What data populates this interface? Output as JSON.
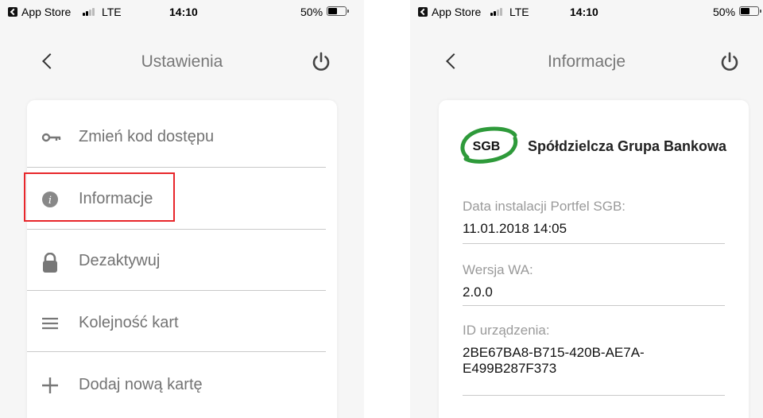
{
  "left": {
    "status": {
      "app": "App Store",
      "network": "LTE",
      "time": "14:10",
      "battery": "50%",
      "battery_level": 0.5
    },
    "nav": {
      "title": "Ustawienia"
    },
    "menu": [
      {
        "label": "Zmień kod dostępu",
        "icon": "key-icon"
      },
      {
        "label": "Informacje",
        "icon": "info-icon"
      },
      {
        "label": "Dezaktywuj",
        "icon": "lock-icon"
      },
      {
        "label": "Kolejność kart",
        "icon": "menu-icon"
      },
      {
        "label": "Dodaj nową kartę",
        "icon": "plus-icon"
      }
    ],
    "highlight_color": "#e8262b"
  },
  "right": {
    "status": {
      "app": "App Store",
      "network": "LTE",
      "time": "14:10",
      "battery": "50%",
      "battery_level": 0.5
    },
    "nav": {
      "title": "Informacje"
    },
    "logo_text": "SGB",
    "bank_name": "Spółdzielcza Grupa Bankowa",
    "install_label": "Data instalacji Portfel SGB:",
    "install_value": "11.01.2018 14:05",
    "version_label": "Wersja WA:",
    "version_value": "2.0.0",
    "device_label": "ID urządzenia:",
    "device_value_line1": "2BE67BA8-B715-420B-AE7A-",
    "device_value_line2": "E499B287F373",
    "brand_green": "#2e9a3a"
  }
}
